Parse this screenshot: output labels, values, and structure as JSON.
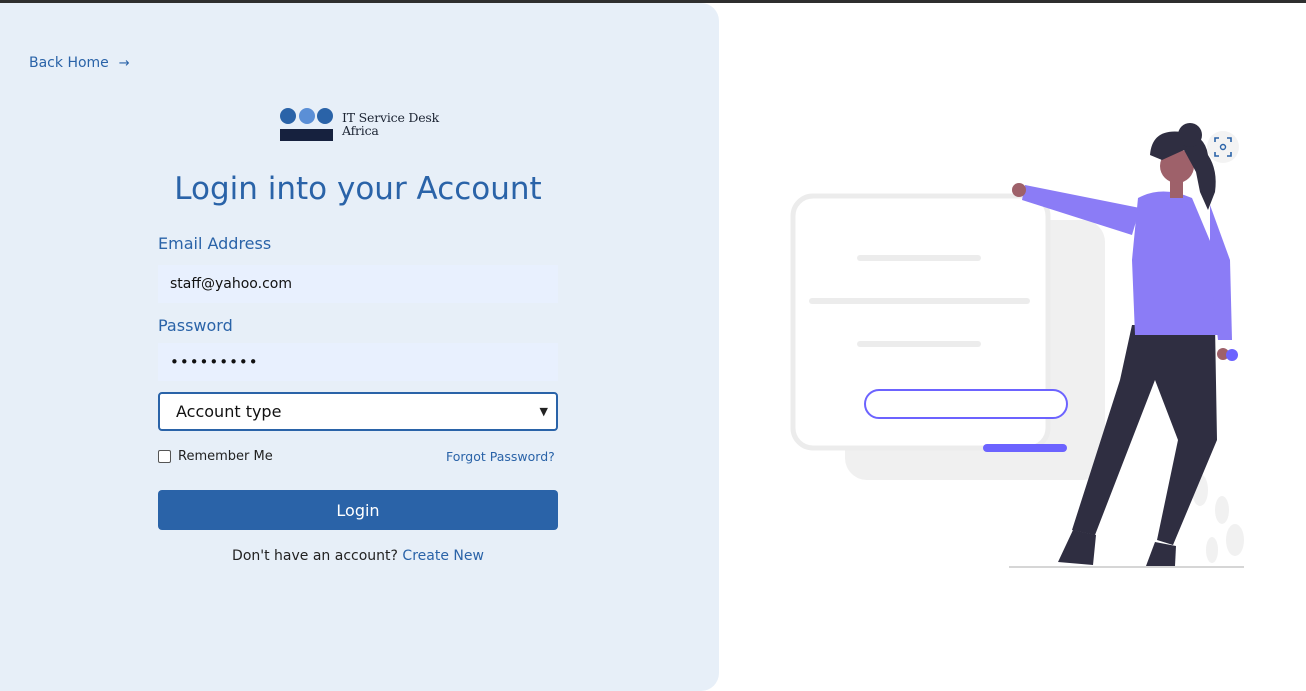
{
  "nav": {
    "back_home": "Back Home",
    "back_arrow": "→"
  },
  "logo": {
    "line1": "IT Service Desk",
    "line2": "Africa",
    "colors": [
      "#2a63a8",
      "#5b8fd6",
      "#2a63a8",
      "#16213e"
    ]
  },
  "form": {
    "title": "Login into your Account",
    "email_label": "Email Address",
    "email_value": "staff@yahoo.com",
    "password_label": "Password",
    "password_value": "•••••••••",
    "account_type": "Account type",
    "remember_me": "Remember Me",
    "forgot_password": "Forgot Password?",
    "login_button": "Login",
    "signup_prompt": "Don't have an account?",
    "create_new": "Create New"
  },
  "colors": {
    "accent": "#2a63a8",
    "panel_bg": "#e7eff8",
    "illustration_purple": "#6c63ff"
  },
  "icons": {
    "arrow": "arrow-right-icon",
    "chevron": "chevron-down-icon",
    "focus": "focus-icon"
  }
}
